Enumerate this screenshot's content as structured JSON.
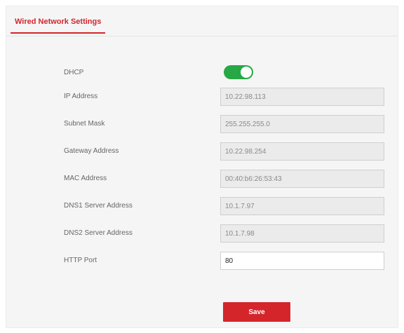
{
  "tab": {
    "label": "Wired Network Settings"
  },
  "colors": {
    "accent": "#d4252b",
    "toggle_on": "#27a844",
    "readonly_field": "#ebebeb",
    "panel_bg": "#f5f5f5"
  },
  "dhcp": {
    "label": "DHCP",
    "enabled": true
  },
  "fields": {
    "ip_address": {
      "label": "IP Address",
      "value": "10.22.98.113"
    },
    "subnet_mask": {
      "label": "Subnet Mask",
      "value": "255.255.255.0"
    },
    "gateway_address": {
      "label": "Gateway Address",
      "value": "10.22.98.254"
    },
    "mac_address": {
      "label": "MAC Address",
      "value": "00:40:b6:26:53:43"
    },
    "dns1_server": {
      "label": "DNS1 Server Address",
      "value": "10.1.7.97"
    },
    "dns2_server": {
      "label": "DNS2 Server Address",
      "value": "10.1.7.98"
    },
    "http_port": {
      "label": "HTTP Port",
      "value": "80"
    }
  },
  "actions": {
    "save_label": "Save"
  }
}
